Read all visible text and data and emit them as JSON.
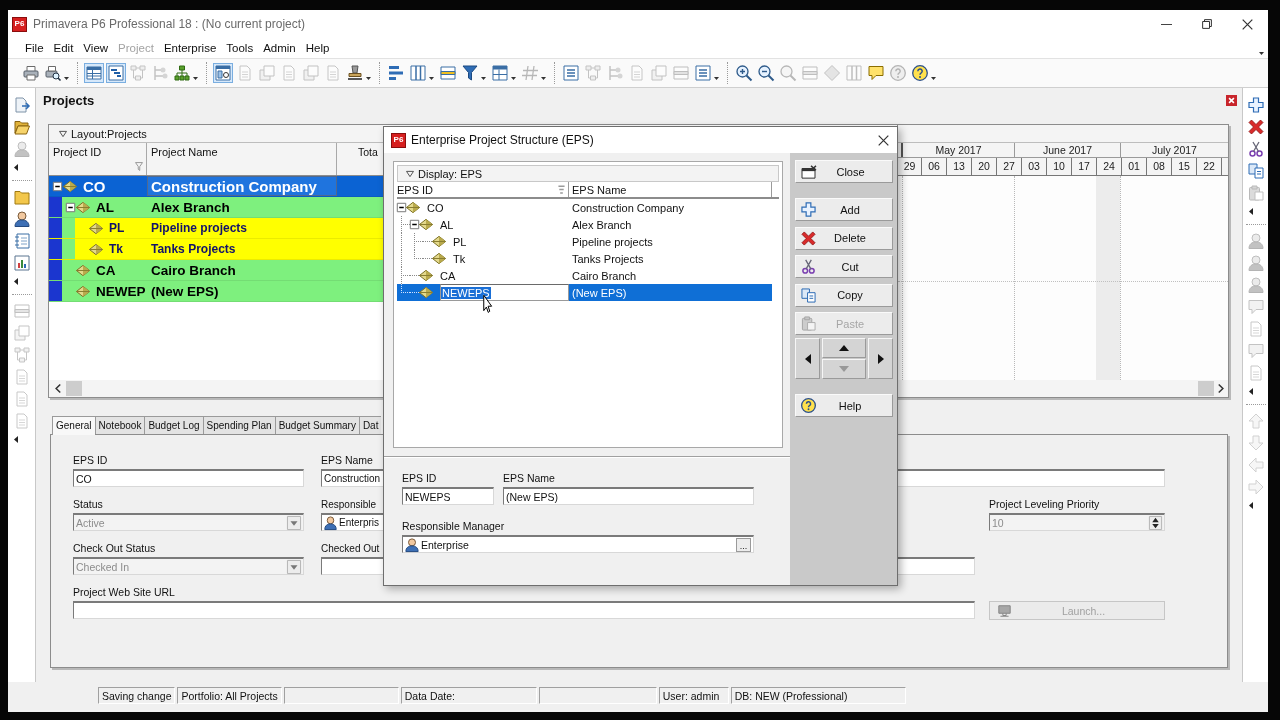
{
  "window": {
    "logo": "P6",
    "title": "Primavera P6 Professional 18 : (No current project)"
  },
  "menu": [
    {
      "label": "File",
      "disabled": false
    },
    {
      "label": "Edit",
      "disabled": false
    },
    {
      "label": "View",
      "disabled": false
    },
    {
      "label": "Project",
      "disabled": true
    },
    {
      "label": "Enterprise",
      "disabled": false
    },
    {
      "label": "Tools",
      "disabled": false
    },
    {
      "label": "Admin",
      "disabled": false
    },
    {
      "label": "Help",
      "disabled": false
    }
  ],
  "toolbar": [
    {
      "selected": false,
      "disabled": false
    },
    {
      "selected": false,
      "disabled": false
    },
    {
      "selected": true,
      "disabled": false
    },
    {
      "selected": true,
      "disabled": false
    },
    {
      "selected": false,
      "disabled": true
    },
    {
      "selected": false,
      "disabled": true
    },
    {
      "selected": false,
      "disabled": false
    },
    {
      "selected": true,
      "disabled": false
    },
    {
      "selected": false,
      "disabled": true
    },
    {
      "selected": false,
      "disabled": true
    },
    {
      "selected": false,
      "disabled": true
    },
    {
      "selected": false,
      "disabled": true
    },
    {
      "selected": false,
      "disabled": true
    },
    {
      "selected": false,
      "disabled": false
    },
    {
      "selected": false,
      "disabled": false
    },
    {
      "selected": false,
      "disabled": false
    },
    {
      "selected": false,
      "disabled": false
    },
    {
      "selected": false,
      "disabled": false
    },
    {
      "selected": false,
      "disabled": false
    },
    {
      "selected": false,
      "disabled": true
    },
    {
      "selected": false,
      "disabled": false
    },
    {
      "selected": false,
      "disabled": true
    },
    {
      "selected": false,
      "disabled": true
    },
    {
      "selected": false,
      "disabled": true
    },
    {
      "selected": false,
      "disabled": true
    },
    {
      "selected": false,
      "disabled": true
    },
    {
      "selected": false,
      "disabled": false
    },
    {
      "selected": false,
      "disabled": false
    },
    {
      "selected": false,
      "disabled": false
    },
    {
      "selected": false,
      "disabled": true
    },
    {
      "selected": false,
      "disabled": true
    },
    {
      "selected": false,
      "disabled": true
    },
    {
      "selected": false,
      "disabled": true
    },
    {
      "selected": false,
      "disabled": false
    },
    {
      "selected": false,
      "disabled": true
    },
    {
      "selected": false,
      "disabled": false
    }
  ],
  "left_toolbar": [
    {
      "disabled": false
    },
    {
      "disabled": false
    },
    {
      "disabled": true
    },
    {
      "disabled": false
    },
    {
      "disabled": false
    },
    {
      "disabled": false
    },
    {
      "disabled": false
    },
    {
      "disabled": true
    },
    {
      "disabled": true
    },
    {
      "disabled": true
    },
    {
      "disabled": true
    },
    {
      "disabled": true
    },
    {
      "disabled": true
    }
  ],
  "right_toolbar": [
    {
      "disabled": false
    },
    {
      "disabled": false
    },
    {
      "disabled": false
    },
    {
      "disabled": false
    },
    {
      "disabled": true
    },
    {
      "disabled": true
    },
    {
      "disabled": true
    },
    {
      "disabled": true
    },
    {
      "disabled": true
    },
    {
      "disabled": true
    },
    {
      "disabled": true
    },
    {
      "disabled": true
    },
    {
      "disabled": true
    },
    {
      "disabled": true
    },
    {
      "disabled": true
    },
    {
      "disabled": true
    }
  ],
  "panel": {
    "title": "Projects"
  },
  "projects_table": {
    "layout": "Layout:Projects",
    "columns": [
      "Project ID",
      "Project Name",
      "Tota"
    ],
    "rows": [
      {
        "id": "CO",
        "name": "Construction Company",
        "expanded": true,
        "selected": true,
        "children": [
          {
            "id": "AL",
            "name": "Alex Branch",
            "expanded": true,
            "selected": false,
            "children": [
              {
                "id": "PL",
                "name": "Pipeline projects",
                "selected": false
              },
              {
                "id": "Tk",
                "name": "Tanks Projects",
                "selected": false
              }
            ]
          },
          {
            "id": "CA",
            "name": "Cairo Branch",
            "selected": false
          },
          {
            "id": "NEWEP",
            "name": "(New EPS)",
            "selected": false
          }
        ]
      }
    ]
  },
  "gantt": {
    "months": [
      "May 2017",
      "June 2017",
      "July 2017"
    ],
    "weeks": [
      "29",
      "06",
      "13",
      "20",
      "27",
      "03",
      "10",
      "17",
      "24",
      "01",
      "08",
      "15",
      "22"
    ]
  },
  "details": {
    "tabs": [
      {
        "label": "General",
        "selected": true
      },
      {
        "label": "Notebook",
        "selected": false
      },
      {
        "label": "Budget Log",
        "selected": false
      },
      {
        "label": "Spending Plan",
        "selected": false
      },
      {
        "label": "Budget Summary",
        "selected": false
      },
      {
        "label": "Dat",
        "selected": false
      }
    ],
    "eps_id": {
      "label": "EPS ID",
      "value": "CO"
    },
    "eps_name": {
      "label": "EPS Name",
      "value": "Construction"
    },
    "status": {
      "label": "Status",
      "value": "Active",
      "disabled": true
    },
    "responsible": {
      "label": "Responsible",
      "value": "Enterpris"
    },
    "leveling_priority": {
      "label": "Project Leveling Priority",
      "value": "10",
      "disabled": true
    },
    "check_out_status": {
      "label": "Check Out Status",
      "value": "Checked In",
      "disabled": true
    },
    "checked_out": {
      "label": "Checked Out"
    },
    "web_site_url": {
      "label": "Project Web Site URL"
    },
    "launch_button": {
      "label": "Launch...",
      "disabled": true
    }
  },
  "dialog": {
    "logo": "P6",
    "title": "Enterprise Project Structure (EPS)",
    "display": "Display: EPS",
    "columns": [
      "EPS ID",
      "EPS Name"
    ],
    "tree": [
      {
        "id": "CO",
        "name": "Construction Company",
        "expanded": true,
        "selected": false,
        "editing": false,
        "children": [
          {
            "id": "AL",
            "name": "Alex Branch",
            "expanded": true,
            "selected": false,
            "editing": false,
            "children": [
              {
                "id": "PL",
                "name": "Pipeline projects",
                "selected": false,
                "editing": false
              },
              {
                "id": "Tk",
                "name": "Tanks Projects",
                "selected": false,
                "editing": false
              }
            ]
          },
          {
            "id": "CA",
            "name": "Cairo Branch",
            "selected": false,
            "editing": false
          },
          {
            "id": "NEWEPS",
            "name": "(New EPS)",
            "selected": true,
            "editing": true
          }
        ]
      }
    ],
    "eps_id": {
      "label": "EPS ID",
      "value": "NEWEPS"
    },
    "eps_name": {
      "label": "EPS Name",
      "value": "(New EPS)"
    },
    "responsible_manager": {
      "label": "Responsible Manager",
      "value": "Enterprise",
      "button": "..."
    },
    "close_button": {
      "label": "Close"
    },
    "edit_buttons": [
      {
        "label": "Add",
        "disabled": false
      },
      {
        "label": "Delete",
        "disabled": false
      },
      {
        "label": "Cut",
        "disabled": false
      },
      {
        "label": "Copy",
        "disabled": false
      },
      {
        "label": "Paste",
        "disabled": true
      }
    ],
    "move_buttons": [
      {
        "disabled": false
      },
      {
        "disabled": false
      },
      {
        "disabled": true
      },
      {
        "disabled": false
      }
    ],
    "help_button": {
      "label": "Help"
    }
  },
  "status_bar": [
    "Saving change",
    "Portfolio: All Projects",
    "Data Date:",
    "User: admin",
    "DB: NEW (Professional)"
  ]
}
